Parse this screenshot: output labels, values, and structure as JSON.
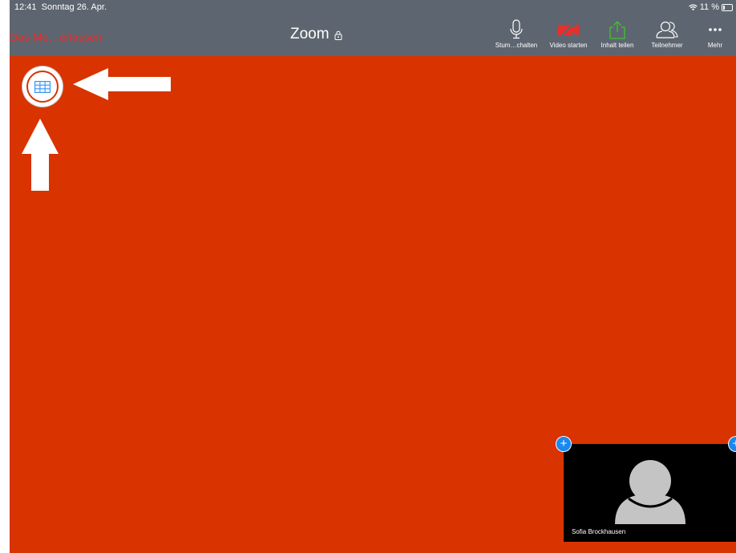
{
  "status_bar": {
    "time": "12:41",
    "date": "Sonntag 26. Apr.",
    "battery": "11 %"
  },
  "toolbar": {
    "leave_label": "Das Me…erlassen",
    "title": "Zoom",
    "buttons": [
      {
        "icon": "microphone-icon",
        "label": "Stum…chalten"
      },
      {
        "icon": "video-off-icon",
        "label": "Video starten",
        "color": "#e5302c"
      },
      {
        "icon": "share-icon",
        "label": "Inhalt teilen",
        "color": "#3ec32c"
      },
      {
        "icon": "participants-icon",
        "label": "Teilnehmer"
      },
      {
        "icon": "more-icon",
        "label": "Mehr"
      }
    ]
  },
  "self_view": {
    "name": "Sofia Brockhausen"
  },
  "colors": {
    "meeting_background": "#d93300",
    "toolbar_background": "#5d6670",
    "leave_red": "#e5302c",
    "badge_blue": "#1a88f0"
  }
}
